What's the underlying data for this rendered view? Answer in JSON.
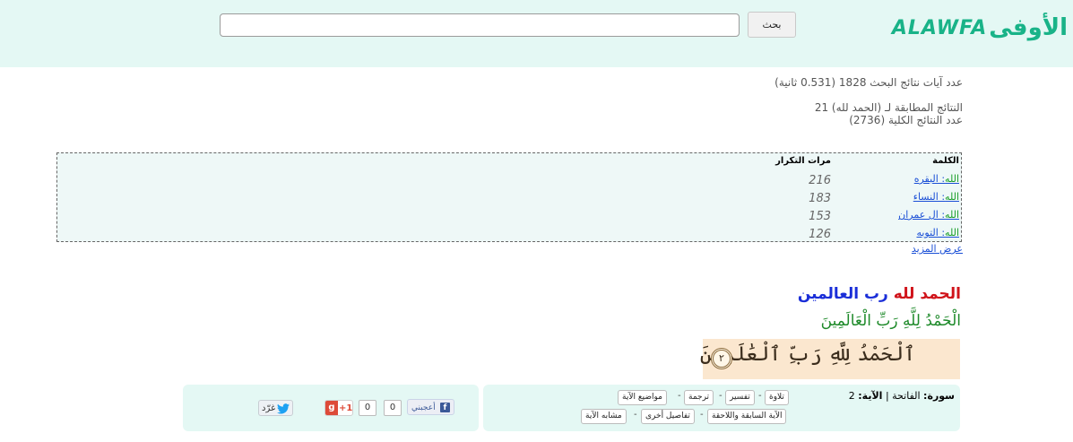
{
  "header": {
    "logo_latin": "ALAWFA",
    "logo_arabic": "الأوفى",
    "search_button": "بحث",
    "search_value": ""
  },
  "stats": {
    "line1": "عدد آيات نتائج البحث 1828 (0.531 ثانية)",
    "line2": "النتائج المطابقة لـ (الحمد لله) 21",
    "line3": "عدد النتائج الكلية (2736)"
  },
  "frequency": {
    "col_word": "الكلمة",
    "col_count": "مرات التكرار",
    "rows": [
      {
        "word": "الله",
        "sura": ": البقره",
        "count": "216"
      },
      {
        "word": "الله",
        "sura": ": النساء",
        "count": "183"
      },
      {
        "word": "الله",
        "sura": ": ال عمران",
        "count": "153"
      },
      {
        "word": "الله",
        "sura": ": التوبه",
        "count": "126"
      }
    ],
    "more": "عرض المزيد"
  },
  "verse": {
    "title_red": "الحمد لله",
    "title_blue": "رب العالمين",
    "diacritized": "الْحَمْدُ لِلَّهِ رَبِّ الْعَالَمِينَ",
    "image_text": "ٱلْحَمْدُ لِلَّهِ رَبِّ ٱلْعَٰلَمِينَ",
    "ayah_number": "٢"
  },
  "info": {
    "sura_label": "سورة:",
    "sura_name": "الفاتحة",
    "separator": "|",
    "ayah_label": "الآية:",
    "ayah_number": "2",
    "links_row1": [
      "تلاوة",
      "تفسير",
      "ترجمة",
      "مواضيع الآية"
    ],
    "links_row2": [
      "الآية السابقة واللاحقة",
      "تفاصيل أخرى",
      "مشابه الآية"
    ]
  },
  "social": {
    "tweet": "غرّد",
    "gplus": "+1",
    "gplus_count": "0",
    "fb_count": "0",
    "fb_like": "أعجبني"
  },
  "colors": {
    "header_bg": "#e4f8f4",
    "brand_green": "#19b388",
    "red": "#d0141b",
    "blue": "#1a2ed8",
    "green": "#1e8a2a"
  }
}
